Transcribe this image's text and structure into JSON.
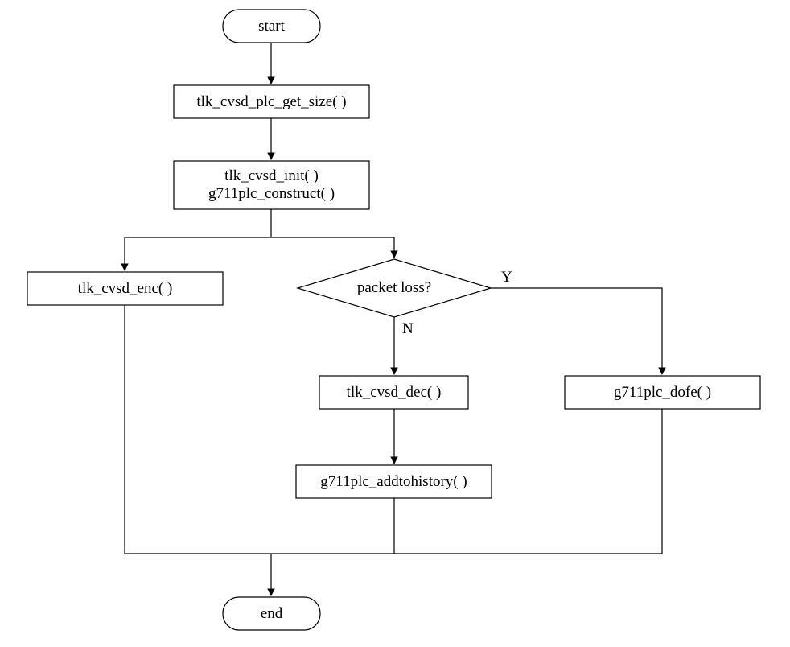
{
  "chart_data": {
    "type": "flowchart",
    "nodes": [
      {
        "id": "start",
        "shape": "terminator",
        "label": "start"
      },
      {
        "id": "get_size",
        "shape": "process",
        "label": "tlk_cvsd_plc_get_size( )"
      },
      {
        "id": "init",
        "shape": "process",
        "label": "tlk_cvsd_init( )\ng711plc_construct( )"
      },
      {
        "id": "enc",
        "shape": "process",
        "label": "tlk_cvsd_enc( )"
      },
      {
        "id": "packet_loss",
        "shape": "decision",
        "label": "packet loss?"
      },
      {
        "id": "dec",
        "shape": "process",
        "label": "tlk_cvsd_dec( )"
      },
      {
        "id": "addhist",
        "shape": "process",
        "label": "g711plc_addtohistory( )"
      },
      {
        "id": "dofe",
        "shape": "process",
        "label": "g711plc_dofe( )"
      },
      {
        "id": "end",
        "shape": "terminator",
        "label": "end"
      }
    ],
    "edges": [
      {
        "from": "start",
        "to": "get_size"
      },
      {
        "from": "get_size",
        "to": "init"
      },
      {
        "from": "init",
        "to": "enc"
      },
      {
        "from": "init",
        "to": "packet_loss"
      },
      {
        "from": "packet_loss",
        "to": "dec",
        "label": "N"
      },
      {
        "from": "packet_loss",
        "to": "dofe",
        "label": "Y"
      },
      {
        "from": "dec",
        "to": "addhist"
      },
      {
        "from": "enc",
        "to": "end"
      },
      {
        "from": "addhist",
        "to": "end"
      },
      {
        "from": "dofe",
        "to": "end"
      }
    ]
  },
  "labels": {
    "start": "start",
    "get_size": "tlk_cvsd_plc_get_size( )",
    "init_line1": "tlk_cvsd_init( )",
    "init_line2": "g711plc_construct( )",
    "enc": "tlk_cvsd_enc( )",
    "packet_loss": "packet loss?",
    "dec": "tlk_cvsd_dec( )",
    "addhist": "g711plc_addtohistory( )",
    "dofe": "g711plc_dofe( )",
    "end": "end",
    "yes": "Y",
    "no": "N"
  }
}
